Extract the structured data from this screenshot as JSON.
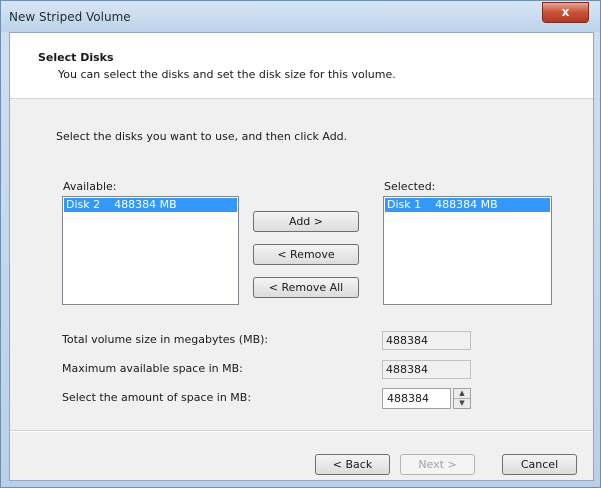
{
  "window": {
    "title": "New Striped Volume",
    "close_label": "x"
  },
  "header": {
    "title": "Select Disks",
    "subtitle": "You can select the disks and set the disk size for this volume."
  },
  "instruction": "Select the disks you want to use, and then click Add.",
  "available": {
    "label": "Available:",
    "items": [
      {
        "label": "Disk 2    488384 MB"
      }
    ]
  },
  "selected": {
    "label": "Selected:",
    "items": [
      {
        "label": "Disk 1    488384 MB"
      }
    ]
  },
  "buttons": {
    "add": "Add >",
    "remove": "< Remove",
    "remove_all": "< Remove All",
    "back": "< Back",
    "next": "Next >",
    "cancel": "Cancel"
  },
  "fields": {
    "total_label": "Total volume size in megabytes (MB):",
    "total_value": "488384",
    "max_label": "Maximum available space in MB:",
    "max_value": "488384",
    "amount_label": "Select the amount of space in MB:",
    "amount_value": "488384"
  }
}
